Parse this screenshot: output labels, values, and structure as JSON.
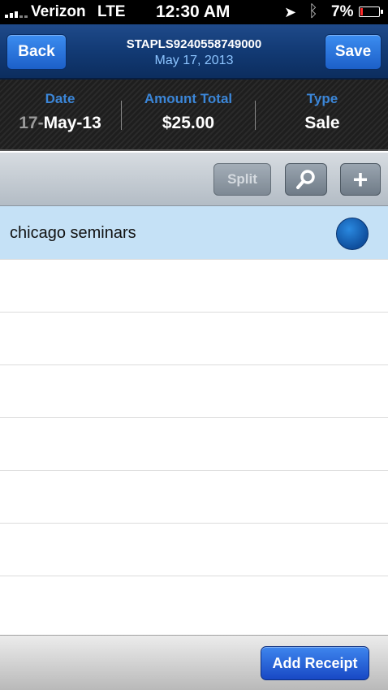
{
  "status_bar": {
    "carrier": "Verizon",
    "network": "LTE",
    "time": "12:30 AM",
    "battery": "7%",
    "battery_level": 0.07
  },
  "nav": {
    "back_label": "Back",
    "save_label": "Save",
    "title": "STAPLS9240558749000",
    "subtitle": "May 17, 2013"
  },
  "summary": {
    "date_label": "Date",
    "date_day": "17-",
    "date_month_year": "May-13",
    "amount_label": "Amount Total",
    "amount_value": "$25.00",
    "type_label": "Type",
    "type_value": "Sale"
  },
  "toolbar": {
    "split_label": "Split",
    "add_symbol": "+"
  },
  "list": {
    "items": [
      {
        "label": "chicago seminars",
        "selected": true
      }
    ]
  },
  "bottom": {
    "add_receipt_label": "Add Receipt"
  },
  "colors": {
    "nav_blue": "#123a74",
    "accent_blue": "#3b86d8",
    "selected_row": "#c5e1f6",
    "button_blue": "#1c5fc8"
  }
}
